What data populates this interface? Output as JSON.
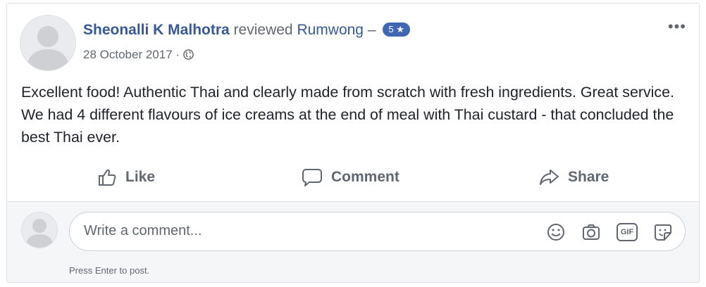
{
  "post": {
    "author": "Sheonalli K Malhotra",
    "action": "reviewed",
    "page": "Rumwong",
    "separator": "–",
    "rating": "5",
    "date": "28 October 2017",
    "date_separator": "·",
    "privacy_icon": "globe-icon",
    "more_label": "•••",
    "text": "Excellent food! Authentic Thai and clearly made from scratch with fresh ingredients. Great service. We had 4 different flavours of ice creams at the end of meal with Thai custard - that concluded the best Thai ever."
  },
  "actions": {
    "like": "Like",
    "comment": "Comment",
    "share": "Share"
  },
  "composer": {
    "placeholder": "Write a comment...",
    "hint": "Press Enter to post.",
    "icons": [
      "emoji-icon",
      "camera-icon",
      "gif-icon",
      "sticker-icon"
    ],
    "gif_label": "GIF"
  },
  "colors": {
    "link": "#365899",
    "badge": "#4267b2",
    "muted": "#606770",
    "text": "#1d2129"
  }
}
